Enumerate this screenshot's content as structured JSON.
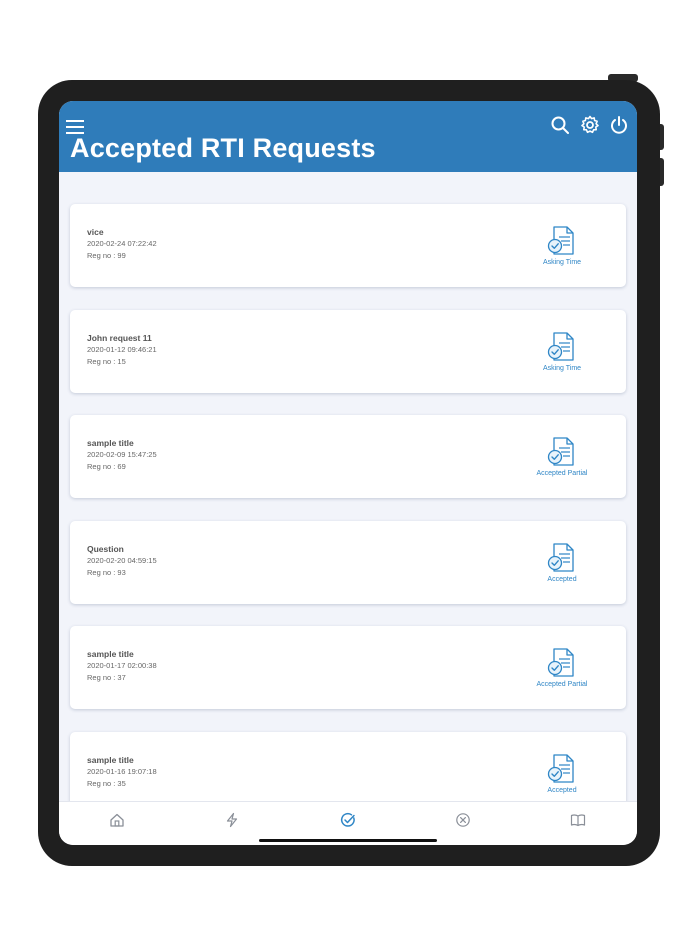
{
  "header": {
    "title": "Accepted RTI Requests",
    "icons": [
      "menu-icon",
      "search-icon",
      "gear-icon",
      "power-icon"
    ],
    "color": "#2f7cba"
  },
  "requests": [
    {
      "title": "vice",
      "date": "2020-02-24 07:22:42",
      "reg": "Reg no : 99",
      "status": "Asking Time"
    },
    {
      "title": "John request 11",
      "date": "2020-01-12 09:46:21",
      "reg": "Reg no : 15",
      "status": "Asking Time"
    },
    {
      "title": "sample title",
      "date": "2020-02-09 15:47:25",
      "reg": "Reg no : 69",
      "status": "Accepted Partial"
    },
    {
      "title": "Question",
      "date": "2020-02-20 04:59:15",
      "reg": "Reg no : 93",
      "status": "Accepted"
    },
    {
      "title": "sample title",
      "date": "2020-01-17 02:00:38",
      "reg": "Reg no : 37",
      "status": "Accepted Partial"
    },
    {
      "title": "sample title",
      "date": "2020-01-16 19:07:18",
      "reg": "Reg no : 35",
      "status": "Accepted"
    }
  ],
  "tabbar": {
    "tabs": [
      "home-icon",
      "lightning-icon",
      "check-circle-icon",
      "x-circle-icon",
      "book-icon"
    ],
    "active": "check-circle-icon",
    "active_color": "#2f86c6",
    "inactive_color": "#8a8f98"
  }
}
